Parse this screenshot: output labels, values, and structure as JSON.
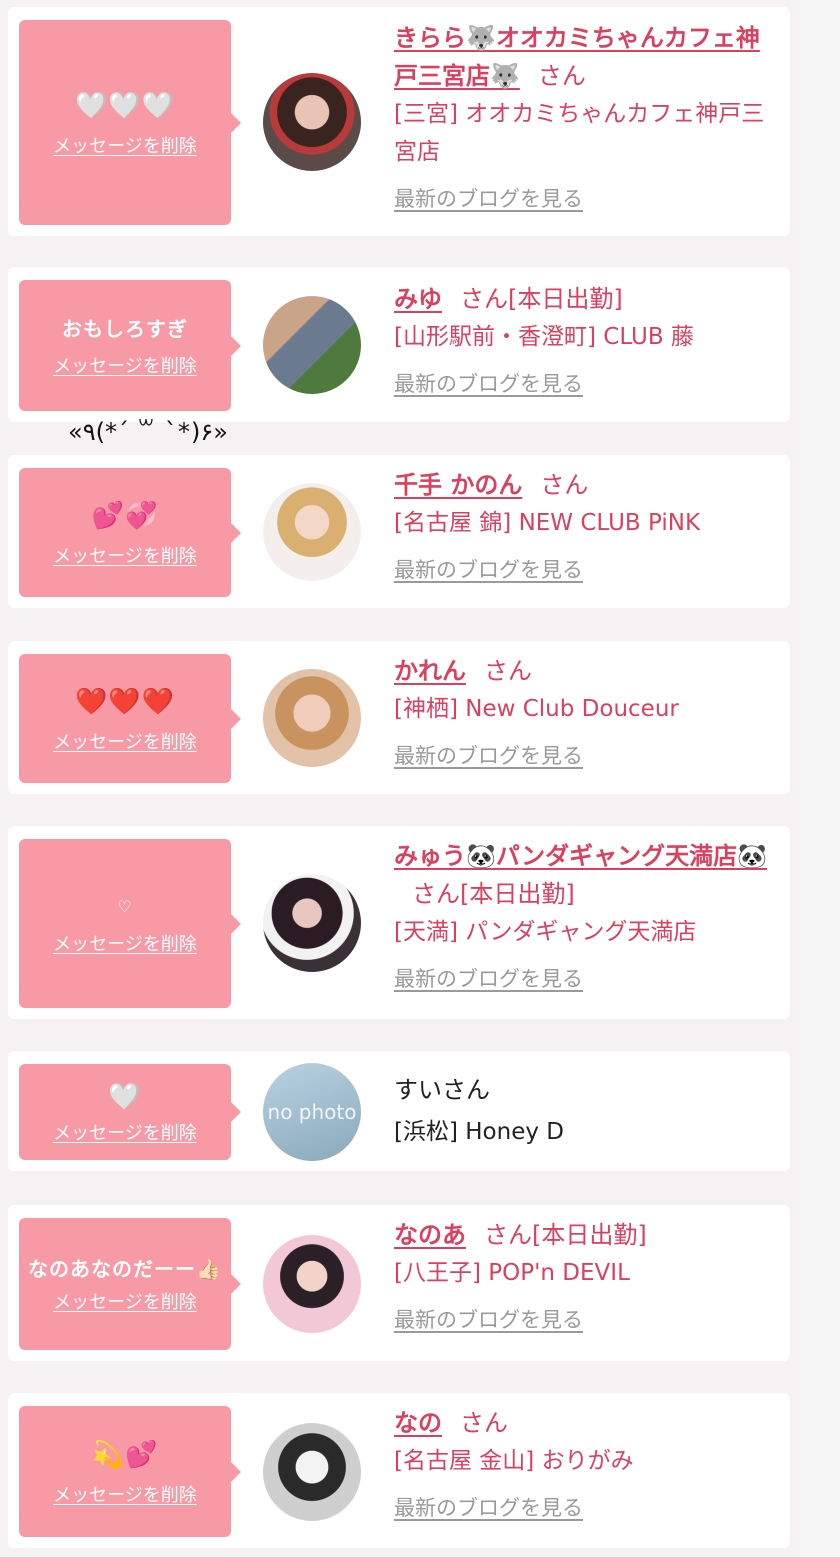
{
  "items": [
    {
      "message": "🤍🤍🤍",
      "delete_label": "メッセージを削除",
      "name": "きらら🐺オオカミちゃんカフェ神戸三宮店🐺",
      "san": "さん",
      "status": "",
      "shop": "[三宮] オオカミちゃんカフェ神戸三宮店",
      "blog": "最新のブログを見る"
    },
    {
      "message": "おもしろすぎ",
      "delete_label": "メッセージを削除",
      "name": "みゆ",
      "san": "さん",
      "status": "[本日出勤]",
      "shop": "[山形駅前・香澄町] CLUB 藤",
      "blog": "最新のブログを見る"
    },
    {
      "message": "💕💞",
      "delete_label": "メッセージを削除",
      "name": "千手 かのん",
      "san": "さん",
      "status": "",
      "shop": "[名古屋 錦] NEW CLUB PiNK",
      "blog": "最新のブログを見る"
    },
    {
      "message": "❤️❤️❤️",
      "delete_label": "メッセージを削除",
      "name": "かれん",
      "san": "さん",
      "status": "",
      "shop": "[神栖] New Club Douceur",
      "blog": "最新のブログを見る"
    },
    {
      "message": "♡",
      "delete_label": "メッセージを削除",
      "name": "みゅう🐼パンダギャング天満店🐼",
      "san": "さん",
      "status": "[本日出勤]",
      "shop": "[天満] パンダギャング天満店",
      "blog": "最新のブログを見る"
    },
    {
      "message": "🤍",
      "delete_label": "メッセージを削除",
      "name": "すいさん",
      "shop": "[浜松] Honey D",
      "photo_text": "no photo"
    },
    {
      "message": "なのあなのだーー👍🏻",
      "delete_label": "メッセージを削除",
      "name": "なのあ",
      "san": "さん",
      "status": "[本日出勤]",
      "shop": "[八王子] POP'n DEVIL",
      "blog": "最新のブログを見る"
    },
    {
      "message": "💫💕",
      "delete_label": "メッセージを削除",
      "name": "なの",
      "san": "さん",
      "status": "",
      "shop": "[名古屋 金山] おりがみ",
      "blog": "最新のブログを見る"
    }
  ],
  "overlay_text": "«٩(*´ ꒳ `*)۶»",
  "colors": {
    "accent": "#d9415f",
    "bubble": "#f89aa6",
    "link_gray": "#9a9a9a"
  }
}
